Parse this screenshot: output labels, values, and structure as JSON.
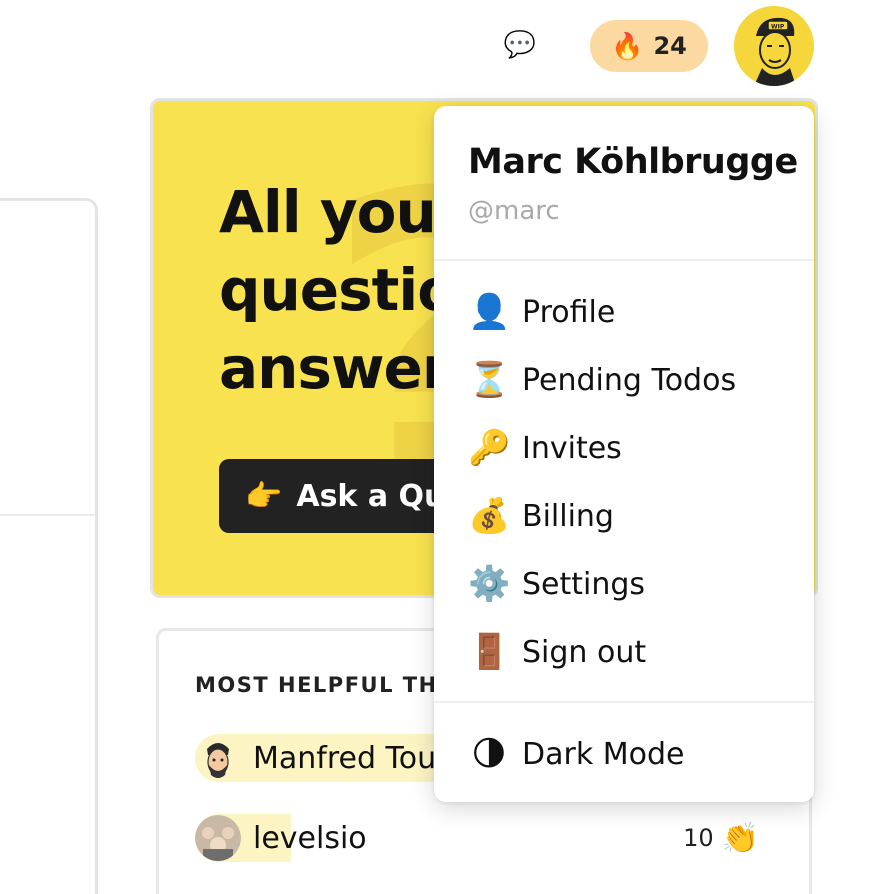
{
  "header": {
    "chat_icon": "💬",
    "streak_icon": "🔥",
    "streak_count": "24",
    "avatar_alt": "WIP"
  },
  "hero": {
    "title_lines": [
      "All your",
      "questions",
      "answered"
    ],
    "ask_emoji": "👉",
    "ask_label": "Ask a Question"
  },
  "helpful": {
    "title": "MOST HELPFUL THIS WEEK",
    "rows": [
      {
        "name": "Manfred Touron",
        "score": ""
      },
      {
        "name": "levelsio",
        "score": "10",
        "clap": "👏"
      }
    ]
  },
  "menu": {
    "name": "Marc Köhlbrugge",
    "handle": "@marc",
    "items": [
      {
        "emoji": "👤",
        "label": "Profile"
      },
      {
        "emoji": "⏳",
        "label": "Pending Todos"
      },
      {
        "emoji": "🔑",
        "label": "Invites"
      },
      {
        "emoji": "💰",
        "label": "Billing"
      },
      {
        "emoji": "⚙️",
        "label": "Settings"
      },
      {
        "emoji": "🚪",
        "label": "Sign out"
      }
    ],
    "dark_mode": {
      "emoji": "🌗",
      "label": "Dark Mode"
    }
  },
  "colors": {
    "hero_bg": "#f9e24f",
    "streak_bg": "#fcd9a1",
    "button_dark": "#222222",
    "helper_pill": "#fdf4c4"
  }
}
